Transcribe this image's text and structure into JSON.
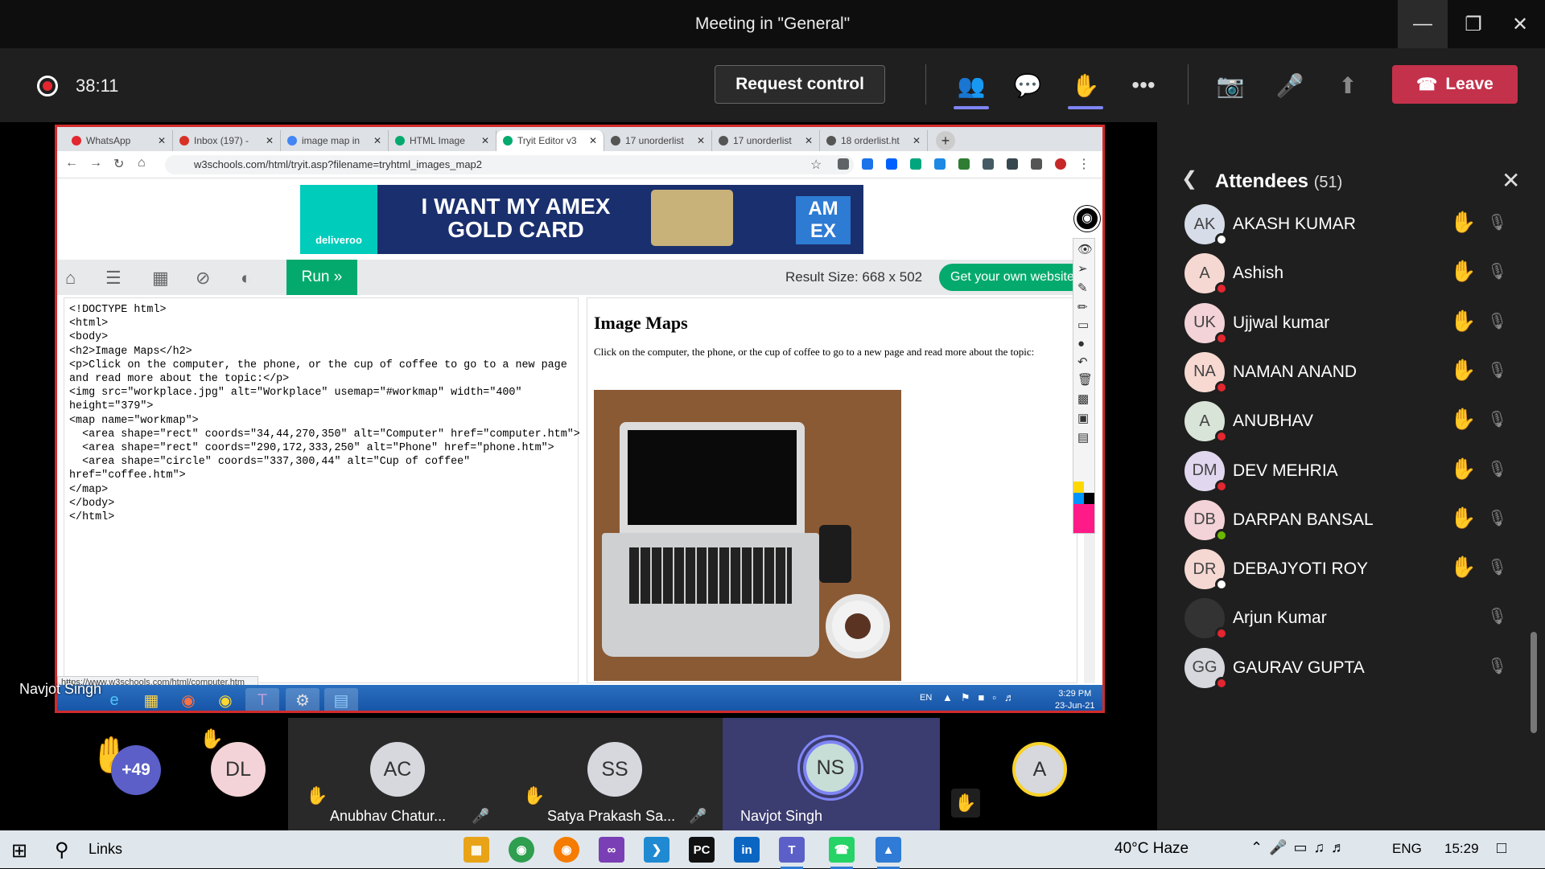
{
  "window": {
    "title": "Meeting in \"General\""
  },
  "toolbar": {
    "timer": "38:11",
    "request_control": "Request control",
    "leave": "Leave"
  },
  "shared_screen": {
    "presenter": "Navjot Singh",
    "tabs": [
      {
        "label": "WhatsApp",
        "color": "#e3262f"
      },
      {
        "label": "Inbox (197) - ",
        "color": "#d93025"
      },
      {
        "label": "image map in",
        "color": "#4285f4"
      },
      {
        "label": "HTML Image",
        "color": "#04aa6d"
      },
      {
        "label": "Tryit Editor v3",
        "color": "#04aa6d"
      },
      {
        "label": "17 unorderlist",
        "color": "#555555"
      },
      {
        "label": "17 unorderlist",
        "color": "#555555"
      },
      {
        "label": "18 orderlist.ht",
        "color": "#555555"
      }
    ],
    "url": "w3schools.com/html/tryit.asp?filename=tryhtml_images_map2",
    "ad": {
      "brand": "deliveroo",
      "headline": "I WANT MY AMEX GOLD CARD",
      "logo": "AM EX"
    },
    "run_label": "Run »",
    "result_size": "Result Size: 668 x 502",
    "get_own": "Get your own website",
    "code_lines": [
      "<!DOCTYPE html>",
      "<html>",
      "<body>",
      "",
      "<h2>Image Maps</h2>",
      "<p>Click on the computer, the phone, or the cup of coffee to go to a new page",
      "and read more about the topic:</p>",
      "",
      "<img src=\"workplace.jpg\" alt=\"Workplace\" usemap=\"#workmap\" width=\"400\"",
      "height=\"379\">",
      "",
      "<map name=\"workmap\">",
      "  <area shape=\"rect\" coords=\"34,44,270,350\" alt=\"Computer\" href=\"computer.htm\">",
      "  <area shape=\"rect\" coords=\"290,172,333,250\" alt=\"Phone\" href=\"phone.htm\">",
      "  <area shape=\"circle\" coords=\"337,300,44\" alt=\"Cup of coffee\"",
      "href=\"coffee.htm\">",
      "</map>",
      "",
      "</body>",
      "</html>"
    ],
    "result_heading": "Image Maps",
    "result_text": "Click on the computer, the phone, or the cup of coffee to go to a new page and read more about the topic:",
    "status_url": "https://www.w3schools.com/html/computer.htm",
    "inner_taskbar": {
      "lang": "EN",
      "time": "3:29 PM",
      "date": "23-Jun-21"
    }
  },
  "participants": [
    {
      "initials": "DL",
      "name": "",
      "overflow": "+49",
      "color": "#f3d3d7"
    },
    {
      "initials": "AC",
      "name": "Anubhav Chatur...",
      "color": "#d6d8de"
    },
    {
      "initials": "SS",
      "name": "Satya Prakash Sa...",
      "color": "#d6d8de"
    },
    {
      "initials": "NS",
      "name": "Navjot Singh",
      "color": "#c6ded5"
    },
    {
      "initials": "A",
      "name": "",
      "color": "#d6d8de"
    }
  ],
  "attendees_panel": {
    "title": "Attendees",
    "count": "(51)",
    "list": [
      {
        "initials": "AK",
        "name": "AKASH KUMAR",
        "hand": true,
        "color": "#d6dde8",
        "status": "#ffffff"
      },
      {
        "initials": "A",
        "name": "Ashish",
        "hand": true,
        "color": "#f6d8d3",
        "status": "#e3262f"
      },
      {
        "initials": "UK",
        "name": "Ujjwal kumar",
        "hand": true,
        "color": "#f3d3d7",
        "status": "#e3262f"
      },
      {
        "initials": "NA",
        "name": "NAMAN ANAND",
        "hand": true,
        "color": "#f7d9d1",
        "status": "#e3262f"
      },
      {
        "initials": "A",
        "name": "ANUBHAV",
        "hand": true,
        "color": "#d8e4d8",
        "status": "#e3262f"
      },
      {
        "initials": "DM",
        "name": "DEV MEHRIA",
        "hand": true,
        "color": "#e1d8ef",
        "status": "#e3262f"
      },
      {
        "initials": "DB",
        "name": "DARPAN BANSAL",
        "hand": true,
        "color": "#f3d3d7",
        "status": "#6bb700"
      },
      {
        "initials": "DR",
        "name": "DEBAJYOTI ROY",
        "hand": true,
        "color": "#f6d8d3",
        "status": "#ffffff"
      },
      {
        "initials": "",
        "name": "Arjun Kumar",
        "hand": false,
        "color": "#333333",
        "status": "#e3262f"
      },
      {
        "initials": "GG",
        "name": "GAURAV GUPTA",
        "hand": false,
        "color": "#d6d8de",
        "status": "#e3262f"
      }
    ]
  },
  "taskbar": {
    "search": "Links",
    "weather": "40°C  Haze",
    "lang": "ENG",
    "time": "15:29"
  }
}
